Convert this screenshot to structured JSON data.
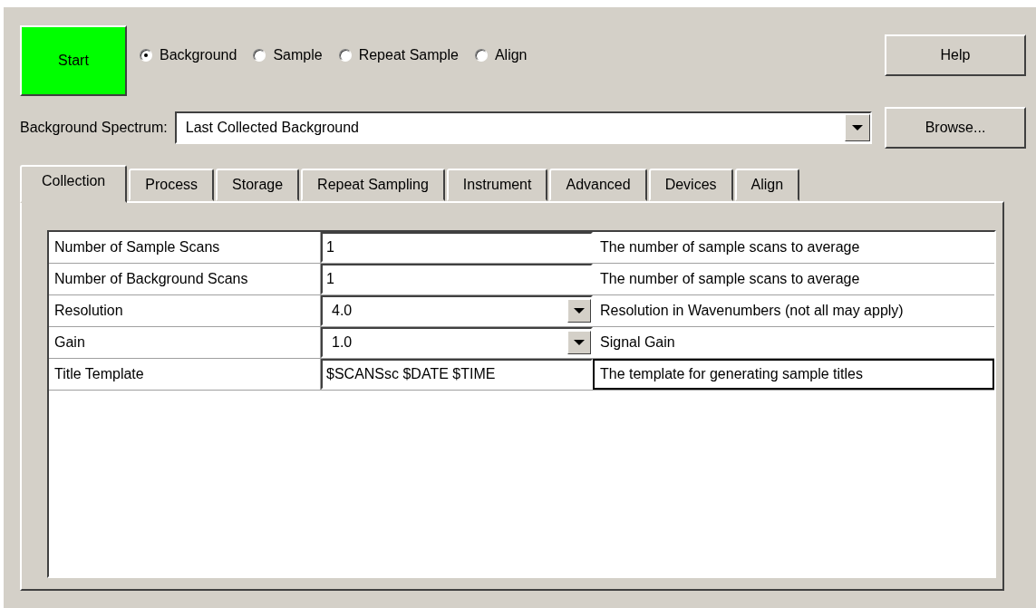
{
  "start_button": {
    "label": "Start"
  },
  "modes": [
    {
      "label": "Background",
      "selected": true
    },
    {
      "label": "Sample",
      "selected": false
    },
    {
      "label": "Repeat Sample",
      "selected": false
    },
    {
      "label": "Align",
      "selected": false
    }
  ],
  "help_button": {
    "label": "Help"
  },
  "background_spectrum": {
    "label": "Background Spectrum:",
    "value": "Last Collected Background"
  },
  "browse_button": {
    "label": "Browse..."
  },
  "tabs": [
    {
      "label": "Collection",
      "selected": true
    },
    {
      "label": "Process",
      "selected": false
    },
    {
      "label": "Storage",
      "selected": false
    },
    {
      "label": "Repeat Sampling",
      "selected": false
    },
    {
      "label": "Instrument",
      "selected": false
    },
    {
      "label": "Advanced",
      "selected": false
    },
    {
      "label": "Devices",
      "selected": false
    },
    {
      "label": "Align",
      "selected": false
    }
  ],
  "table": {
    "rows": [
      {
        "name": "Number of Sample Scans",
        "kind": "text",
        "value": "1",
        "description": "The number of sample scans to average",
        "selected": false
      },
      {
        "name": "Number of Background Scans",
        "kind": "text",
        "value": "1",
        "description": "The number of sample scans to average",
        "selected": false
      },
      {
        "name": "Resolution",
        "kind": "dropdown",
        "value": "4.0",
        "description": "Resolution in Wavenumbers (not all may apply)",
        "selected": false
      },
      {
        "name": "Gain",
        "kind": "dropdown",
        "value": "1.0",
        "description": "Signal Gain",
        "selected": false
      },
      {
        "name": "Title Template",
        "kind": "text",
        "value": "$SCANSsc $DATE $TIME",
        "description": "The template for generating sample titles",
        "selected": true
      }
    ]
  }
}
